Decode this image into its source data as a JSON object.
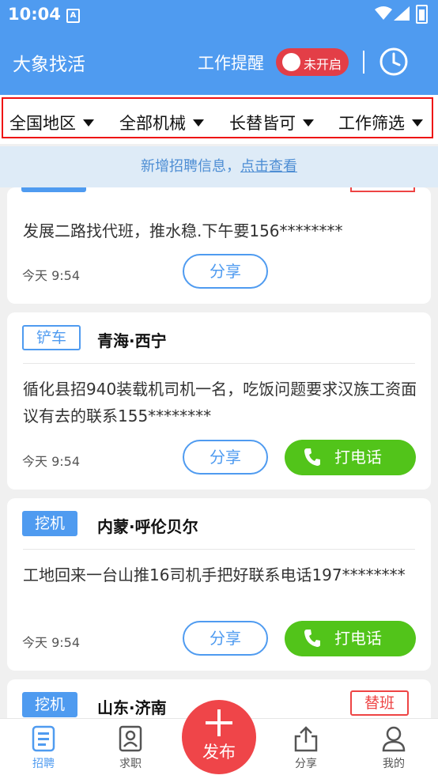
{
  "status_bar": {
    "time": "10:04",
    "notification_icon": "A"
  },
  "header": {
    "title": "大象找活",
    "reminder_label": "工作提醒",
    "reminder_toggle_text": "未开启",
    "toggle_color": "#e33e47",
    "brand_color": "#4f9bf0"
  },
  "filters": [
    {
      "label": "全国地区"
    },
    {
      "label": "全部机械"
    },
    {
      "label": "长替皆可"
    },
    {
      "label": "工作筛选"
    }
  ],
  "notice": {
    "prefix": "新增招聘信息，",
    "link": "点击查看"
  },
  "jobs": [
    {
      "description": "发展二路找代班，推水稳.下午要156********",
      "time": "今天 9:54",
      "share_label": "分享"
    },
    {
      "tag": "铲车",
      "location": "青海·西宁",
      "description": "循化县招940装载机司机一名，吃饭问题要求汉族工资面议有去的联系155********",
      "time": "今天 9:54",
      "share_label": "分享",
      "call_label": "打电话"
    },
    {
      "tag": "挖机",
      "location": "内蒙·呼伦贝尔",
      "description": "工地回来一台山推16司机手把好联系电话197********",
      "time": "今天 9:54",
      "share_label": "分享",
      "call_label": "打电话"
    },
    {
      "tag": "挖机",
      "location": "山东·济南",
      "type_tag": "替班"
    }
  ],
  "bottom_nav": {
    "recruit": "招聘",
    "job_seek": "求职",
    "publish": "发布",
    "share": "分享",
    "mine": "我的"
  },
  "call_color": "#52c41a"
}
